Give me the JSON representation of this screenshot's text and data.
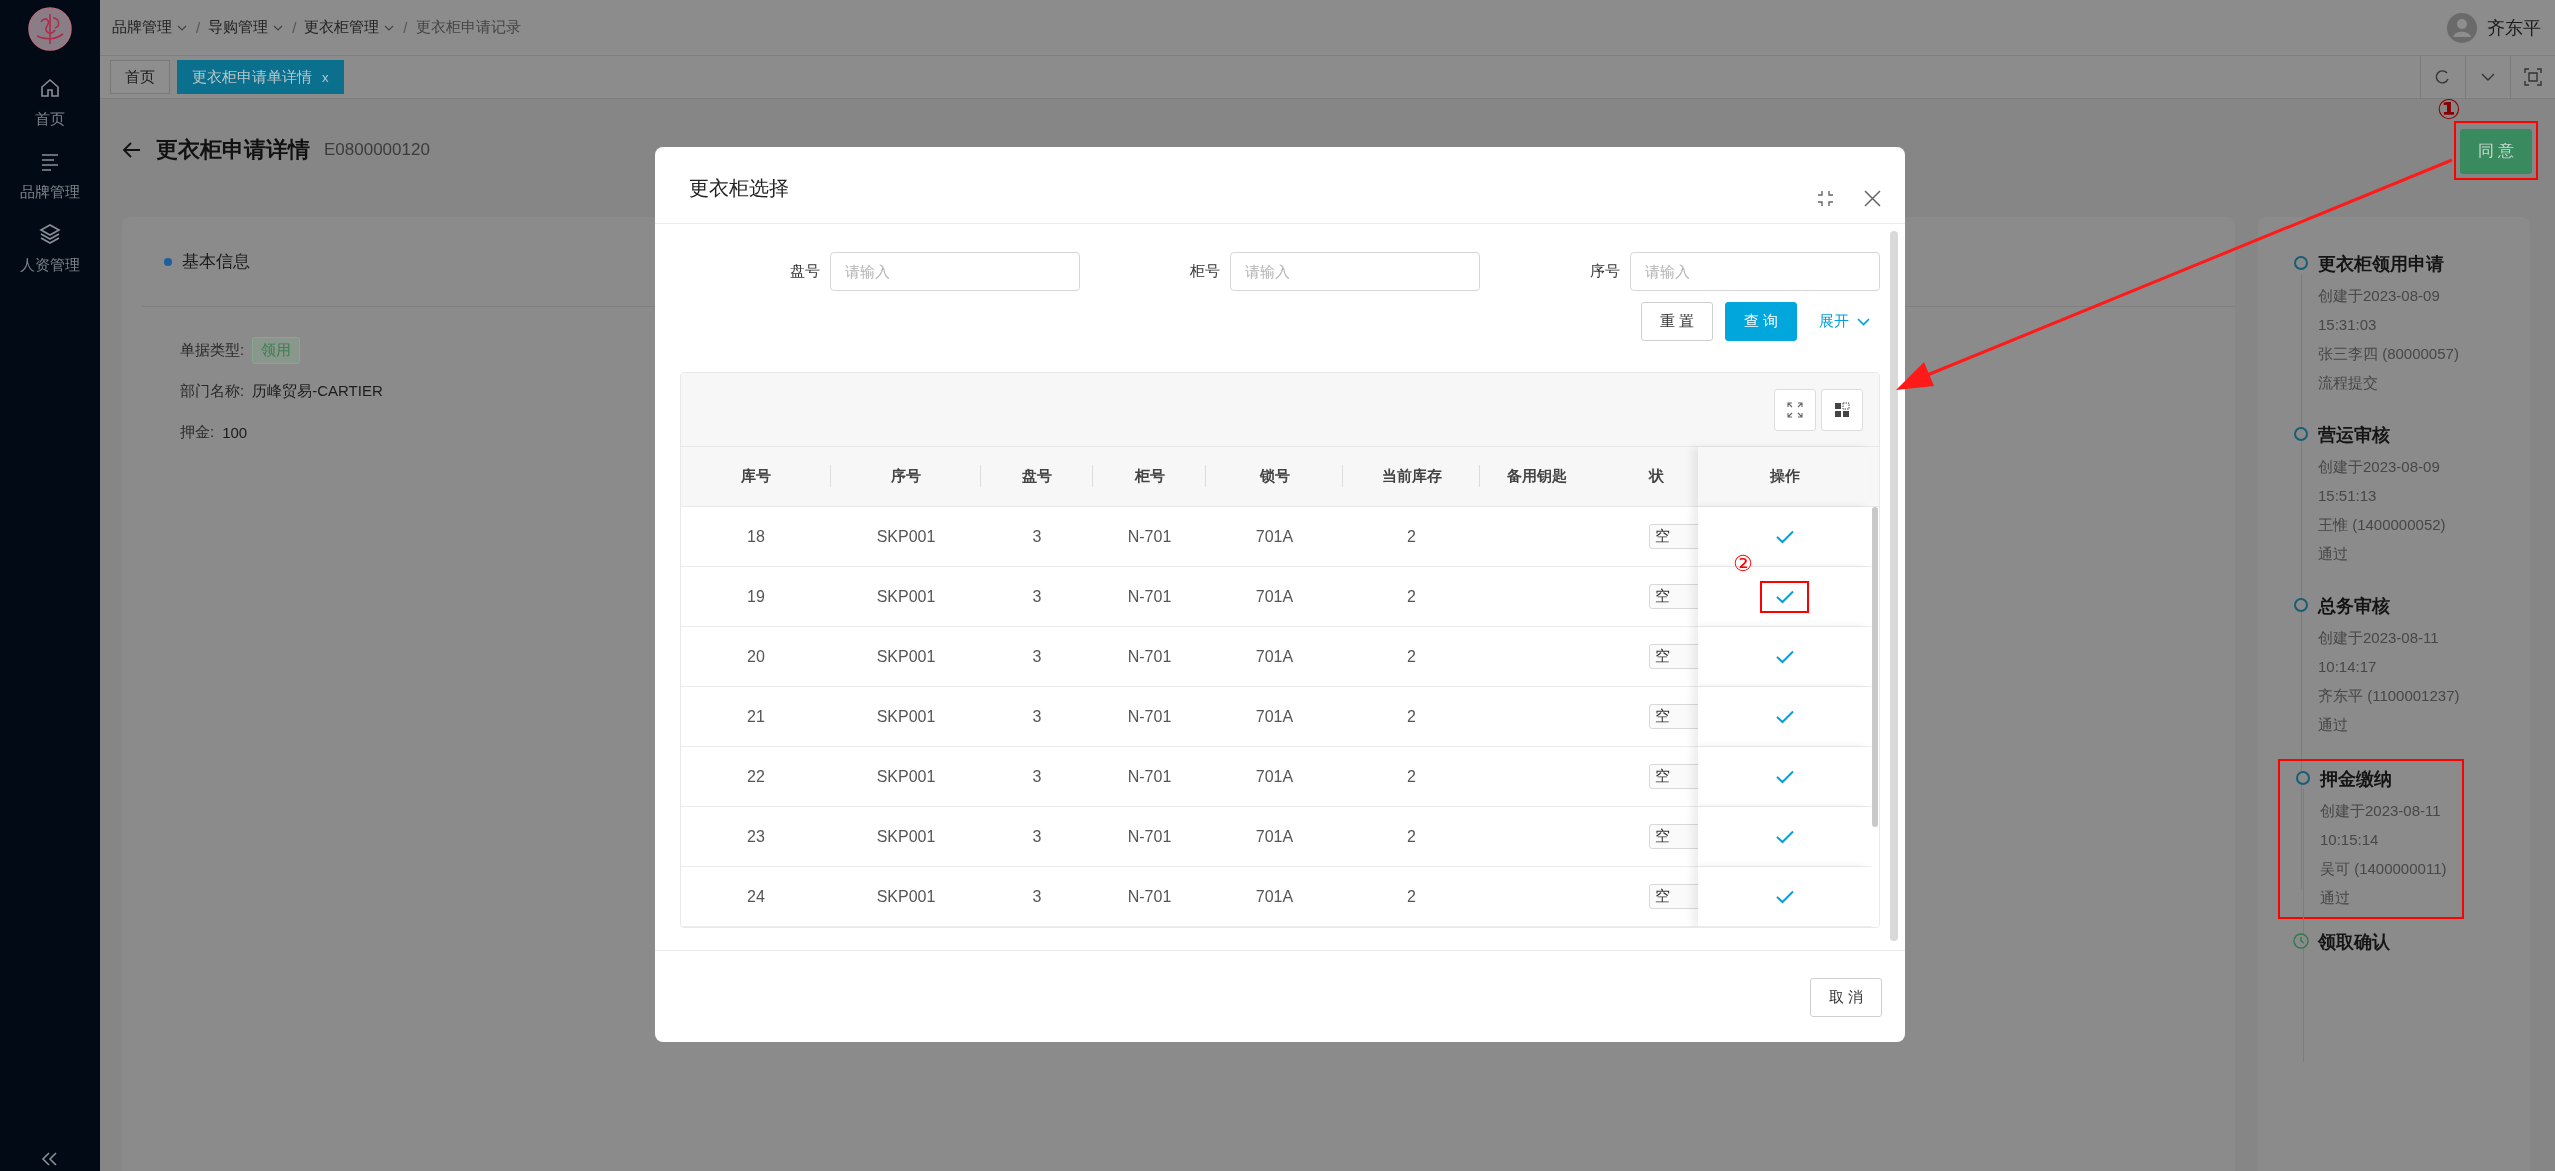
{
  "sidebar": {
    "items": [
      {
        "label": "首页",
        "selected": false
      },
      {
        "label": "品牌管理",
        "selected": false
      },
      {
        "label": "人资管理",
        "selected": false
      }
    ]
  },
  "breadcrumb": [
    {
      "label": "品牌管理",
      "dropdown": true
    },
    {
      "separator": "/",
      "label": "导购管理",
      "dropdown": true
    },
    {
      "separator": "/",
      "label": "更衣柜管理",
      "dropdown": true
    },
    {
      "separator": "/",
      "label": "更衣柜申请记录",
      "dropdown": false
    }
  ],
  "user": {
    "name": "齐东平"
  },
  "tabs": [
    {
      "label": "首页",
      "selected": false
    },
    {
      "label": "更衣柜申请单详情",
      "selected": true,
      "close": "x"
    }
  ],
  "page": {
    "title": "更衣柜申请详情",
    "code": "E0800000120",
    "approve_button": {
      "label": "同 意",
      "highlighted": true,
      "mark": "①"
    }
  },
  "basic_info": {
    "heading": "基本信息",
    "fields": [
      {
        "label": "单据类型:",
        "kind": "tag",
        "value": "领用"
      },
      {
        "label": "部门名称:",
        "kind": "text",
        "value": "历峰贸易-CARTIER"
      },
      {
        "label": "押金:",
        "kind": "text",
        "value": "100"
      }
    ]
  },
  "timeline": [
    {
      "title": "更衣柜领用申请",
      "completed": true,
      "highlighted": false,
      "lines": [
        "创建于2023-08-09",
        "15:31:03",
        "张三李四 (80000057)",
        "流程提交"
      ]
    },
    {
      "title": "营运审核",
      "completed": true,
      "highlighted": false,
      "lines": [
        "创建于2023-08-09",
        "15:51:13",
        "王惟 (1400000052)",
        "通过"
      ]
    },
    {
      "title": "总务审核",
      "completed": true,
      "highlighted": false,
      "lines": [
        "创建于2023-08-11",
        "10:14:17",
        "齐东平 (1100001237)",
        "通过"
      ]
    },
    {
      "title": "押金缴纳",
      "completed": true,
      "highlighted": true,
      "lines": [
        "创建于2023-08-11",
        "10:15:14",
        "吴可 (1400000011)",
        "通过"
      ]
    },
    {
      "title": "领取确认",
      "completed": false,
      "highlighted": false
    }
  ],
  "modal": {
    "title": "更衣柜选择",
    "filters": [
      {
        "label": "盘号",
        "placeholder": "请输入"
      },
      {
        "label": "柜号",
        "placeholder": "请输入"
      },
      {
        "label": "序号",
        "placeholder": "请输入"
      }
    ],
    "reset_button": "重 置",
    "search_button": "查 询",
    "expand_link": "展开",
    "table": {
      "columns": [
        "库号",
        "序号",
        "盘号",
        "柜号",
        "锁号",
        "当前库存",
        "备用钥匙",
        "状"
      ],
      "action_column": "操作",
      "rows": [
        {
          "cells": [
            "18",
            "SKP001",
            "3",
            "N-701",
            "701A",
            "2"
          ],
          "status": "空",
          "highlighted": false
        },
        {
          "cells": [
            "19",
            "SKP001",
            "3",
            "N-701",
            "701A",
            "2"
          ],
          "status": "空",
          "highlighted": true,
          "mark": "②"
        },
        {
          "cells": [
            "20",
            "SKP001",
            "3",
            "N-701",
            "701A",
            "2"
          ],
          "status": "空",
          "highlighted": false
        },
        {
          "cells": [
            "21",
            "SKP001",
            "3",
            "N-701",
            "701A",
            "2"
          ],
          "status": "空",
          "highlighted": false
        },
        {
          "cells": [
            "22",
            "SKP001",
            "3",
            "N-701",
            "701A",
            "2"
          ],
          "status": "空",
          "highlighted": false
        },
        {
          "cells": [
            "23",
            "SKP001",
            "3",
            "N-701",
            "701A",
            "2"
          ],
          "status": "空",
          "highlighted": false
        },
        {
          "cells": [
            "24",
            "SKP001",
            "3",
            "N-701",
            "701A",
            "2"
          ],
          "status": "空",
          "highlighted": false
        }
      ]
    },
    "cancel_button": "取 消"
  }
}
